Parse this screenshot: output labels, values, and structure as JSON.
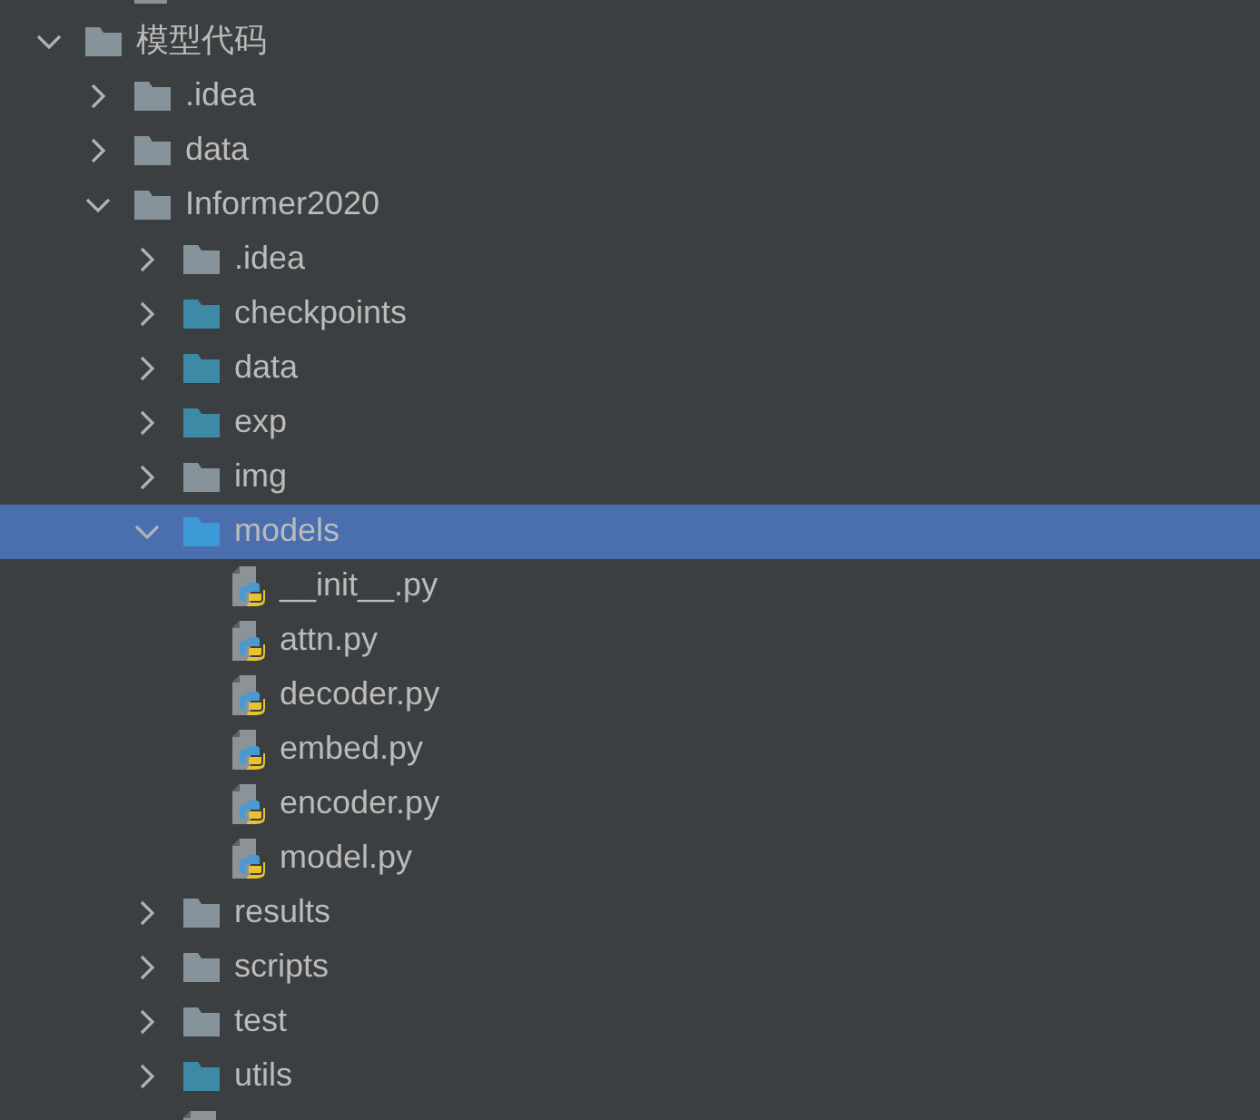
{
  "cut_top": {
    "kind": "image"
  },
  "tree": [
    {
      "name": "模型代码",
      "kind": "folder",
      "color": "#87939a",
      "expanded": true,
      "selected": false,
      "children": [
        {
          "name": ".idea",
          "kind": "folder",
          "color": "#87939a",
          "expanded": false,
          "selected": false
        },
        {
          "name": "data",
          "kind": "folder",
          "color": "#87939a",
          "expanded": false,
          "selected": false
        },
        {
          "name": "Informer2020",
          "kind": "folder",
          "color": "#87939a",
          "expanded": true,
          "selected": false,
          "children": [
            {
              "name": ".idea",
              "kind": "folder",
              "color": "#87939a",
              "expanded": false,
              "selected": false
            },
            {
              "name": "checkpoints",
              "kind": "folder",
              "color": "#3d8aa6",
              "expanded": false,
              "selected": false
            },
            {
              "name": "data",
              "kind": "folder",
              "color": "#3d8aa6",
              "expanded": false,
              "selected": false
            },
            {
              "name": "exp",
              "kind": "folder",
              "color": "#3d8aa6",
              "expanded": false,
              "selected": false
            },
            {
              "name": "img",
              "kind": "folder",
              "color": "#87939a",
              "expanded": false,
              "selected": false
            },
            {
              "name": "models",
              "kind": "folder",
              "color": "#3d9ad6",
              "expanded": true,
              "selected": true,
              "children": [
                {
                  "name": "__init__.py",
                  "kind": "python",
                  "selected": false
                },
                {
                  "name": "attn.py",
                  "kind": "python",
                  "selected": false
                },
                {
                  "name": "decoder.py",
                  "kind": "python",
                  "selected": false
                },
                {
                  "name": "embed.py",
                  "kind": "python",
                  "selected": false
                },
                {
                  "name": "encoder.py",
                  "kind": "python",
                  "selected": false
                },
                {
                  "name": "model.py",
                  "kind": "python",
                  "selected": false
                }
              ]
            },
            {
              "name": "results",
              "kind": "folder",
              "color": "#87939a",
              "expanded": false,
              "selected": false
            },
            {
              "name": "scripts",
              "kind": "folder",
              "color": "#87939a",
              "expanded": false,
              "selected": false
            },
            {
              "name": "test",
              "kind": "folder",
              "color": "#87939a",
              "expanded": false,
              "selected": false
            },
            {
              "name": "utils",
              "kind": "folder",
              "color": "#3d8aa6",
              "expanded": false,
              "selected": false
            },
            {
              "kind": "file",
              "selected": false
            }
          ]
        }
      ]
    }
  ]
}
